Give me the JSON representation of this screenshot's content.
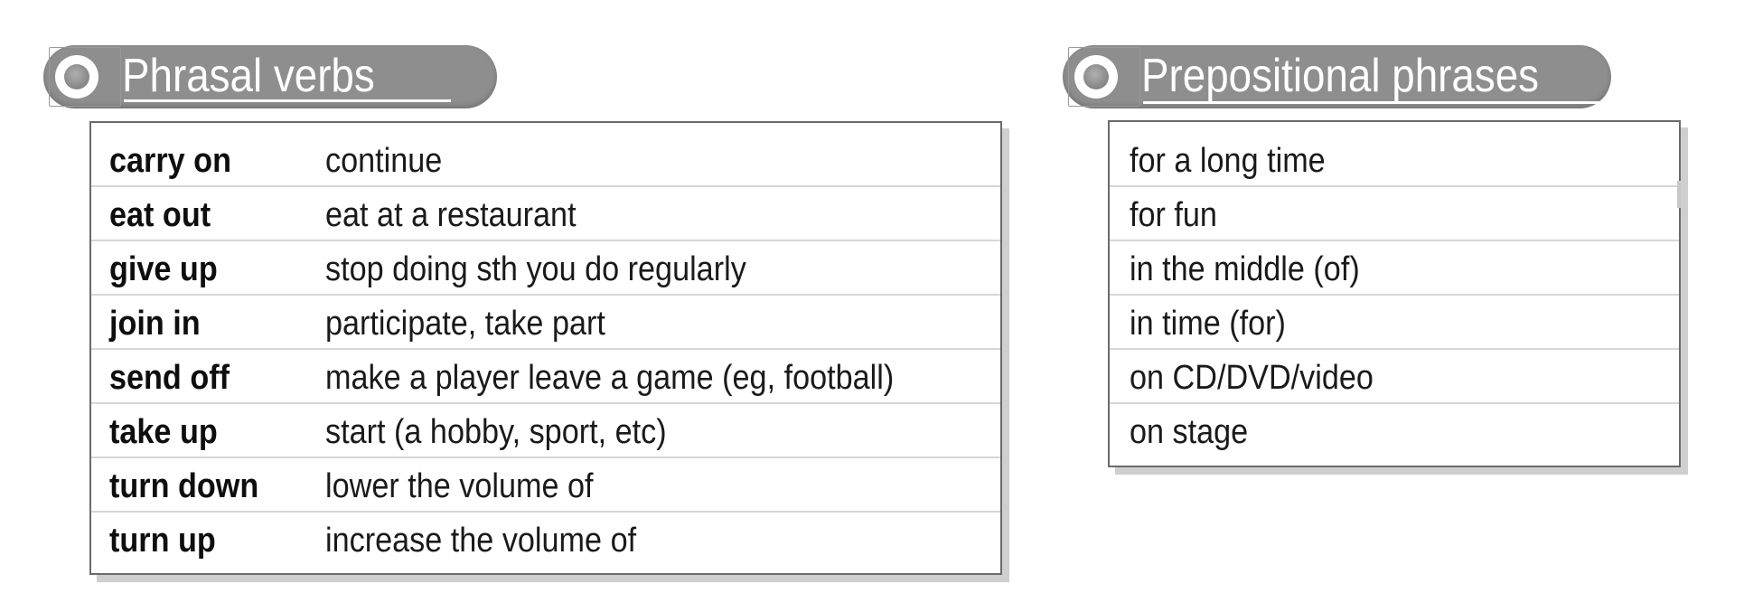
{
  "phrasal_verbs": {
    "title": "Phrasal verbs",
    "rows": [
      {
        "term": "carry on",
        "definition": "continue"
      },
      {
        "term": "eat out",
        "definition": "eat at a restaurant"
      },
      {
        "term": "give up",
        "definition": "stop doing sth you do regularly"
      },
      {
        "term": "join in",
        "definition": "participate, take part"
      },
      {
        "term": "send off",
        "definition": "make a player leave a game (eg, football)"
      },
      {
        "term": "take up",
        "definition": "start (a hobby, sport, etc)"
      },
      {
        "term": "turn down",
        "definition": "lower the volume of"
      },
      {
        "term": "turn up",
        "definition": "increase the volume of"
      }
    ]
  },
  "prepositional_phrases": {
    "title": "Prepositional phrases",
    "rows": [
      {
        "phrase": "for a long time"
      },
      {
        "phrase": "for fun"
      },
      {
        "phrase": "in the middle (of)"
      },
      {
        "phrase": "in time (for)"
      },
      {
        "phrase": "on CD/DVD/video"
      },
      {
        "phrase": "on stage"
      }
    ]
  }
}
